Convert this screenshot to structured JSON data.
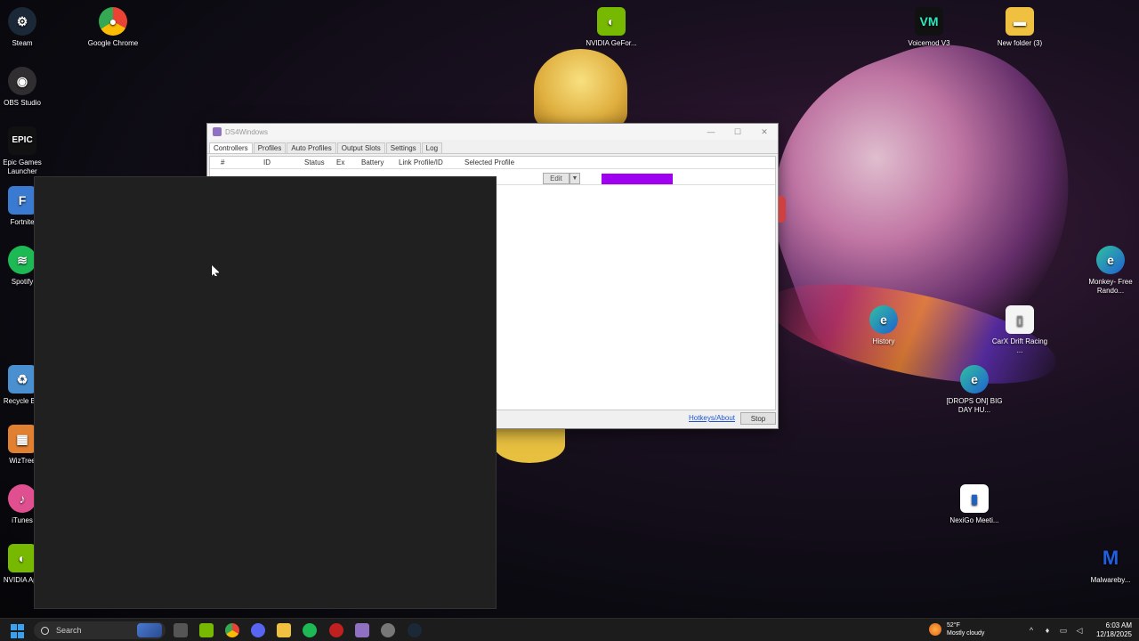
{
  "desktop": {
    "icons_left": [
      {
        "label": "Steam",
        "icon": "steam-icon",
        "color": "#1b2838"
      },
      {
        "label": "OBS Studio",
        "icon": "obs-icon",
        "color": "#302e31"
      },
      {
        "label": "Epic Games Launcher",
        "icon": "epic-icon",
        "color": "#2a2a2a"
      },
      {
        "label": "Fortnite",
        "icon": "fortnite-icon",
        "color": "#3a7ad0"
      },
      {
        "label": "Spotify",
        "icon": "spotify-icon",
        "color": "#1db954"
      },
      {
        "label": "Recycle Bin",
        "icon": "recycle-bin-icon",
        "color": "#4a90d0"
      },
      {
        "label": "WizTree",
        "icon": "wiztree-icon",
        "color": "#e08030"
      },
      {
        "label": "iTunes",
        "icon": "itunes-icon",
        "color": "#e05090"
      },
      {
        "label": "NVIDIA App",
        "icon": "nvidia-icon",
        "color": "#76b900"
      }
    ],
    "icon_chrome": {
      "label": "Google Chrome",
      "icon": "chrome-icon"
    },
    "icon_nvidia_gf": {
      "label": "NVIDIA GeFor...",
      "icon": "nvidia-icon"
    },
    "icon_voicemod": {
      "label": "Voicemod V3",
      "icon": "voicemod-icon"
    },
    "icon_newfolder": {
      "label": "New folder (3)",
      "icon": "folder-icon"
    },
    "icon_monkey": {
      "label": "Monkey- Free Rando...",
      "icon": "edge-icon"
    },
    "icon_history": {
      "label": "History",
      "icon": "edge-icon"
    },
    "icon_carx": {
      "label": "CarX Drift Racing ...",
      "icon": "file-icon"
    },
    "icon_drops": {
      "label": "[DROPS ON] BIG DAY HU...",
      "icon": "edge-icon"
    },
    "icon_nexigo": {
      "label": "NexiGo Meeti...",
      "icon": "nexigo-icon"
    },
    "icon_malware": {
      "label": "Malwareby...",
      "icon": "malwarebytes-icon"
    }
  },
  "window": {
    "title": "DS4Windows",
    "tabs": [
      "Controllers",
      "Profiles",
      "Auto Profiles",
      "Output Slots",
      "Settings",
      "Log"
    ],
    "active_tab": "Controllers",
    "columns": [
      "#",
      "ID",
      "Status",
      "Ex",
      "Battery",
      "Link Profile/ID",
      "Selected Profile"
    ],
    "row": {
      "edit_label": "Edit",
      "lightbar_color": "#a000f0"
    },
    "hotkeys_label": "Hotkeys/About",
    "stop_label": "Stop"
  },
  "taskbar": {
    "search_placeholder": "Search",
    "weather_temp": "52°F",
    "weather_text": "Mostly cloudy",
    "time": "6:03 AM",
    "date": "12/18/2025"
  }
}
